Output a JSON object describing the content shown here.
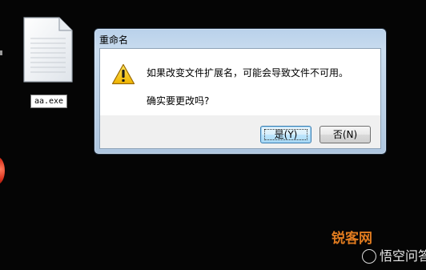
{
  "desktop": {
    "file_name": "aa.exe"
  },
  "dialog": {
    "title": "重命名",
    "message": "如果改变文件扩展名，可能会导致文件不可用。",
    "question": "确实要更改吗?",
    "yes_label": "是(Y)",
    "no_label": "否(N)",
    "icon": "warning-icon"
  },
  "watermark": {
    "logo_text": "锐客网",
    "caption": "悟空问答"
  },
  "colors": {
    "background": "#050505",
    "dialog_frame": "#b9d1ea",
    "warning_yellow": "#f5c400",
    "default_button": "#bee6fd",
    "watermark_orange": "#e07b1f"
  }
}
